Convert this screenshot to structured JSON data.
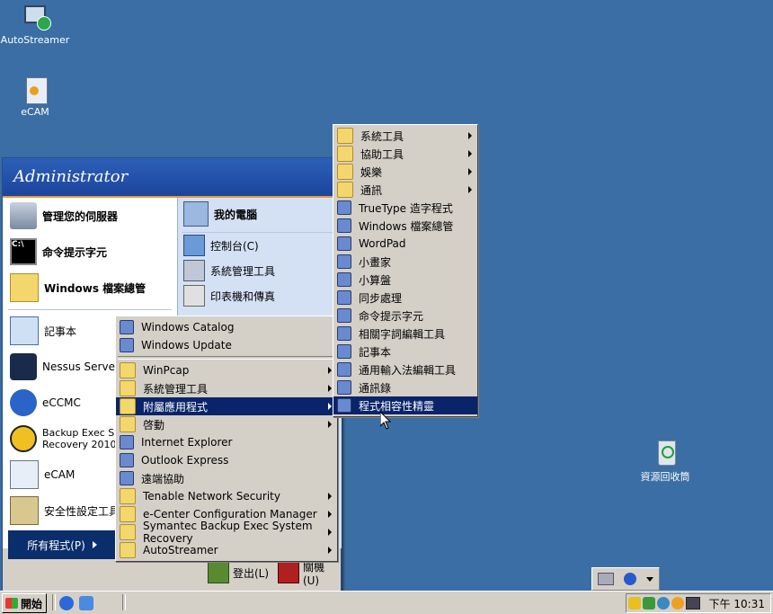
{
  "desktop": {
    "icons": [
      {
        "label": "AutoStreamer"
      },
      {
        "label": "eCAM"
      },
      {
        "label": "資源回收筒"
      }
    ]
  },
  "start_menu": {
    "user": "Administrator",
    "pinned": [
      {
        "label": "管理您的伺服器"
      },
      {
        "label": "命令提示字元"
      },
      {
        "label": "Windows 檔案總管"
      }
    ],
    "recent": [
      {
        "label": "記事本"
      },
      {
        "label": "Nessus Server Ma"
      },
      {
        "label": "eCCMC"
      },
      {
        "label": "Backup Exec Sys",
        "label2": "Recovery 2010"
      },
      {
        "label": "eCAM"
      },
      {
        "label": "安全性設定工具"
      }
    ],
    "right": [
      {
        "label": "我的電腦"
      },
      {
        "label": "控制台(C)"
      },
      {
        "label": "系統管理工具"
      },
      {
        "label": "印表機和傳真"
      }
    ],
    "all_programs": "所有程式(P)",
    "logoff": "登出(L)",
    "shutdown": "關機(U)"
  },
  "programs_menu": {
    "items": [
      {
        "label": "Windows Catalog",
        "arrow": false
      },
      {
        "label": "Windows Update",
        "arrow": false
      },
      {
        "label": "WinPcap",
        "arrow": true
      },
      {
        "label": "系統管理工具",
        "arrow": true
      },
      {
        "label": "附屬應用程式",
        "arrow": true
      },
      {
        "label": "啓動",
        "arrow": true
      },
      {
        "label": "Internet Explorer",
        "arrow": false
      },
      {
        "label": "Outlook Express",
        "arrow": false
      },
      {
        "label": "遠端協助",
        "arrow": false
      },
      {
        "label": "Tenable Network Security",
        "arrow": true
      },
      {
        "label": "e-Center Configuration Manager",
        "arrow": true
      },
      {
        "label": "Symantec Backup Exec System Recovery",
        "arrow": true
      },
      {
        "label": "AutoStreamer",
        "arrow": true
      }
    ]
  },
  "accessories_menu": {
    "items": [
      {
        "label": "系統工具",
        "arrow": true
      },
      {
        "label": "協助工具",
        "arrow": true
      },
      {
        "label": "娛樂",
        "arrow": true
      },
      {
        "label": "通訊",
        "arrow": true
      },
      {
        "label": "TrueType 造字程式",
        "arrow": false
      },
      {
        "label": "Windows 檔案總管",
        "arrow": false
      },
      {
        "label": "WordPad",
        "arrow": false
      },
      {
        "label": "小畫家",
        "arrow": false
      },
      {
        "label": "小算盤",
        "arrow": false
      },
      {
        "label": "同步處理",
        "arrow": false
      },
      {
        "label": "命令提示字元",
        "arrow": false
      },
      {
        "label": "相關字詞編輯工具",
        "arrow": false
      },
      {
        "label": "記事本",
        "arrow": false
      },
      {
        "label": "通用輸入法編輯工具",
        "arrow": false
      },
      {
        "label": "通訊錄",
        "arrow": false
      },
      {
        "label": "程式相容性精靈",
        "arrow": false
      }
    ]
  },
  "taskbar": {
    "start": "開始",
    "clock": "下午 10:31"
  },
  "colors": {
    "desktop": "#3a6ea5",
    "highlight": "#0a246a",
    "menu": "#d4d0c8"
  }
}
